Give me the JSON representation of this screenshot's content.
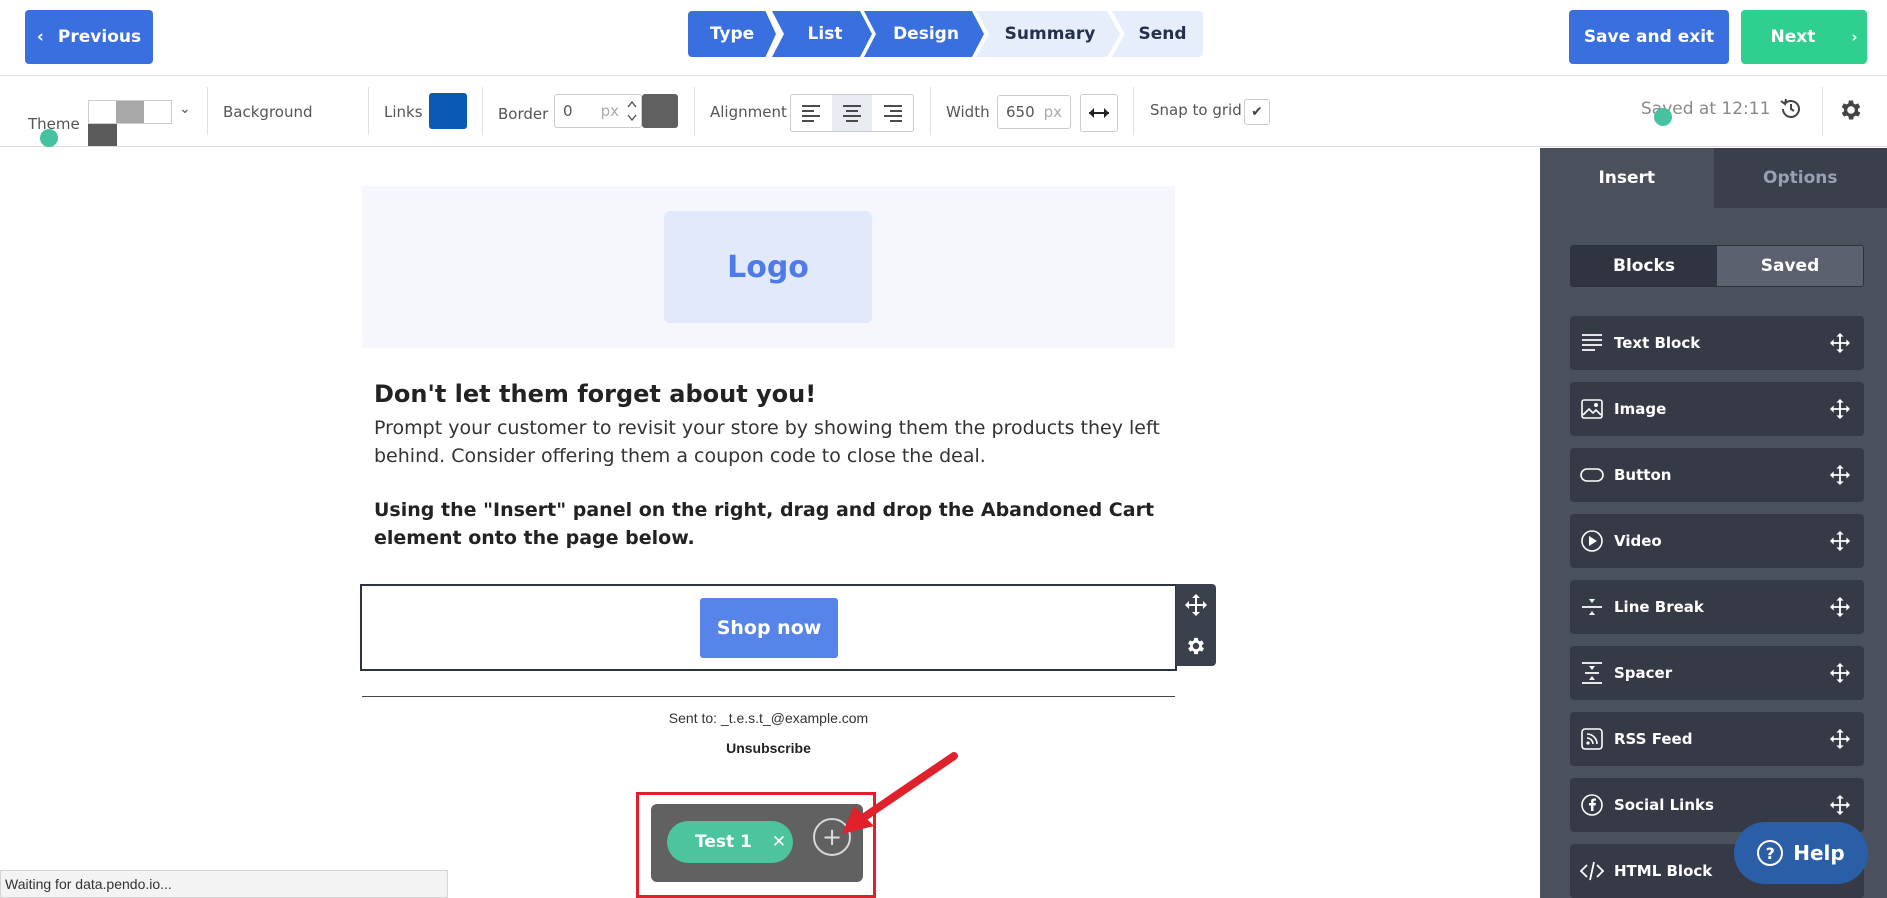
{
  "topnav": {
    "previous_label": "Previous",
    "previous_chevron": "‹",
    "save_exit_label": "Save and exit",
    "next_label": "Next",
    "next_chevron": "›",
    "steps": [
      {
        "label": "Type",
        "state": "done"
      },
      {
        "label": "List",
        "state": "done"
      },
      {
        "label": "Design",
        "state": "done"
      },
      {
        "label": "Summary",
        "state": "todo"
      },
      {
        "label": "Send",
        "state": "todo"
      }
    ]
  },
  "toolbar": {
    "theme_label": "Theme",
    "theme_chevron": "⌄",
    "theme_colors": [
      "#ffffff",
      "#a8a8a8",
      "#ffffff",
      "#5a5a5a"
    ],
    "background_label": "Background",
    "links_label": "Links",
    "links_color": "#0a5ab5",
    "border_label": "Border",
    "border_value": "0",
    "border_unit": "px",
    "border_color": "#5f5f5f",
    "alignment_label": "Alignment",
    "alignment_selected": "center",
    "width_label": "Width",
    "width_value": "650",
    "width_unit": "px",
    "snap_label": "Snap to grid",
    "snap_checked": "✔",
    "saved_text": "Saved at 12:11"
  },
  "email": {
    "logo_text": "Logo",
    "headline": "Don't let them forget about you!",
    "body": "Prompt your customer to revisit your store by showing them the products they left behind. Consider offering them a coupon code to close the deal.",
    "instruction": "Using the \"Insert\" panel on the right, drag and drop the Abandoned Cart element onto the page below.",
    "shop_button": "Shop now",
    "sent_to": "Sent to: _t.e.s.t_@example.com",
    "unsubscribe": "Unsubscribe"
  },
  "test_panel": {
    "pill_label": "Test 1",
    "close_glyph": "✕",
    "add_glyph": "+"
  },
  "status_bar": "Waiting for data.pendo.io...",
  "right_panel": {
    "tabs": [
      "Insert",
      "Options"
    ],
    "subtabs": [
      "Blocks",
      "Saved"
    ],
    "blocks": [
      {
        "label": "Text Block",
        "icon": "text-lines-icon"
      },
      {
        "label": "Image",
        "icon": "image-icon"
      },
      {
        "label": "Button",
        "icon": "button-icon"
      },
      {
        "label": "Video",
        "icon": "play-icon"
      },
      {
        "label": "Line Break",
        "icon": "line-break-icon"
      },
      {
        "label": "Spacer",
        "icon": "spacer-icon"
      },
      {
        "label": "RSS Feed",
        "icon": "rss-icon"
      },
      {
        "label": "Social Links",
        "icon": "facebook-icon"
      },
      {
        "label": "HTML Block",
        "icon": "code-icon"
      }
    ]
  },
  "help_label": "Help",
  "help_glyph": "?",
  "colors": {
    "primary": "#3a6fe0",
    "success": "#2fcf8f",
    "panel": "#4b505d",
    "highlight": "#e0202a"
  }
}
